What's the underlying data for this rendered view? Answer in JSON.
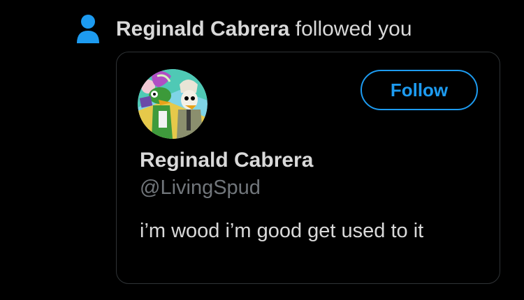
{
  "notification": {
    "icon": "person-icon",
    "user_name": "Reginald Cabrera",
    "action_text": " followed you"
  },
  "profile_card": {
    "avatar_icon": "avatar",
    "follow_label": "Follow",
    "display_name": "Reginald Cabrera",
    "handle": "@LivingSpud",
    "bio": "i’m wood i’m good get used to it"
  },
  "colors": {
    "background": "#000000",
    "accent": "#1d9bf0",
    "text_primary": "#d9d9d9",
    "text_secondary": "#71767b",
    "border": "#2f3336"
  }
}
